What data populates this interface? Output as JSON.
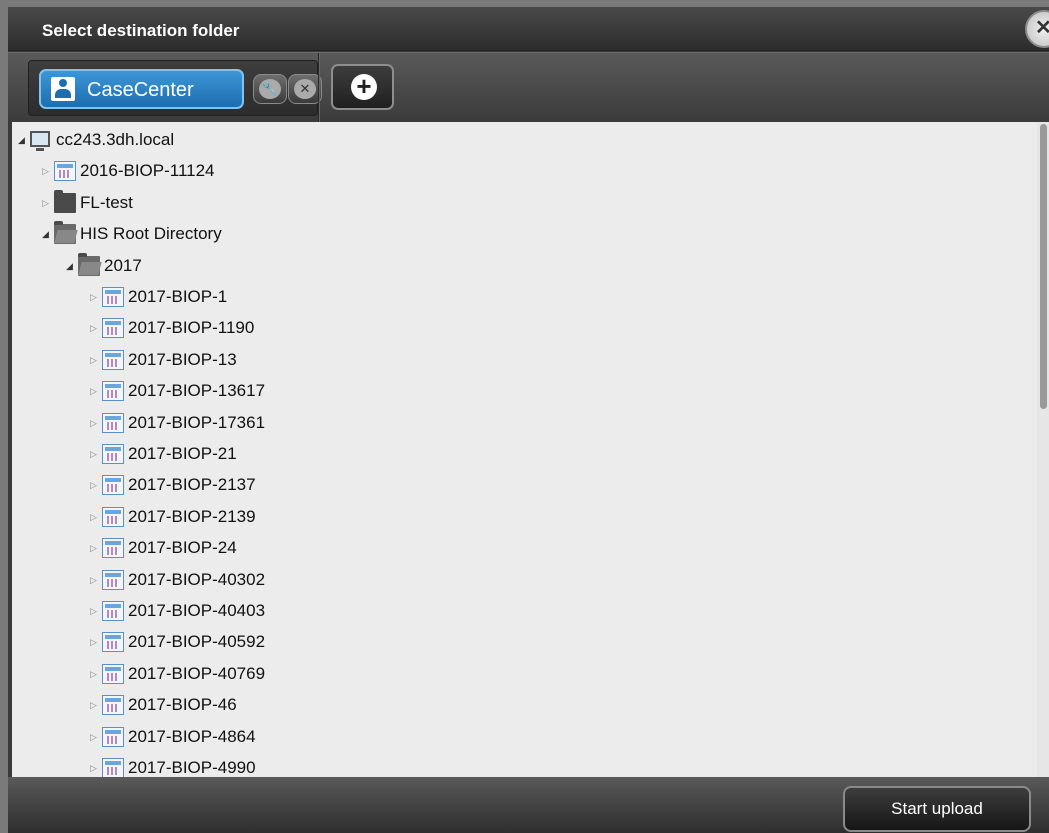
{
  "dialog": {
    "title": "Select destination folder",
    "close_glyph": "✕"
  },
  "toolbar": {
    "server_label": "CaseCenter",
    "server_icon": "user-icon",
    "edit_glyph": "🔧",
    "remove_glyph": "✕",
    "add_glyph": "+"
  },
  "tree": {
    "root": {
      "label": "cc243.3dh.local",
      "icon": "server-icon",
      "expanded": true
    },
    "level1": [
      {
        "label": "2016-BIOP-11124",
        "icon": "case-icon",
        "expanded": false
      },
      {
        "label": "FL-test",
        "icon": "folder-icon",
        "expanded": false
      },
      {
        "label": "HIS Root Directory",
        "icon": "folder-open-icon",
        "expanded": true
      }
    ],
    "level2": [
      {
        "label": "2017",
        "icon": "folder-open-icon",
        "expanded": true
      }
    ],
    "level3": [
      {
        "label": "2017-BIOP-1"
      },
      {
        "label": "2017-BIOP-1190"
      },
      {
        "label": "2017-BIOP-13"
      },
      {
        "label": "2017-BIOP-13617"
      },
      {
        "label": "2017-BIOP-17361"
      },
      {
        "label": "2017-BIOP-21"
      },
      {
        "label": "2017-BIOP-2137"
      },
      {
        "label": "2017-BIOP-2139"
      },
      {
        "label": "2017-BIOP-24"
      },
      {
        "label": "2017-BIOP-40302"
      },
      {
        "label": "2017-BIOP-40403"
      },
      {
        "label": "2017-BIOP-40592"
      },
      {
        "label": "2017-BIOP-40769"
      },
      {
        "label": "2017-BIOP-46"
      },
      {
        "label": "2017-BIOP-4864"
      },
      {
        "label": "2017-BIOP-4990"
      }
    ]
  },
  "footer": {
    "upload_label": "Start upload"
  },
  "colors": {
    "accent": "#2a82c4",
    "tree_background": "#ececec"
  }
}
